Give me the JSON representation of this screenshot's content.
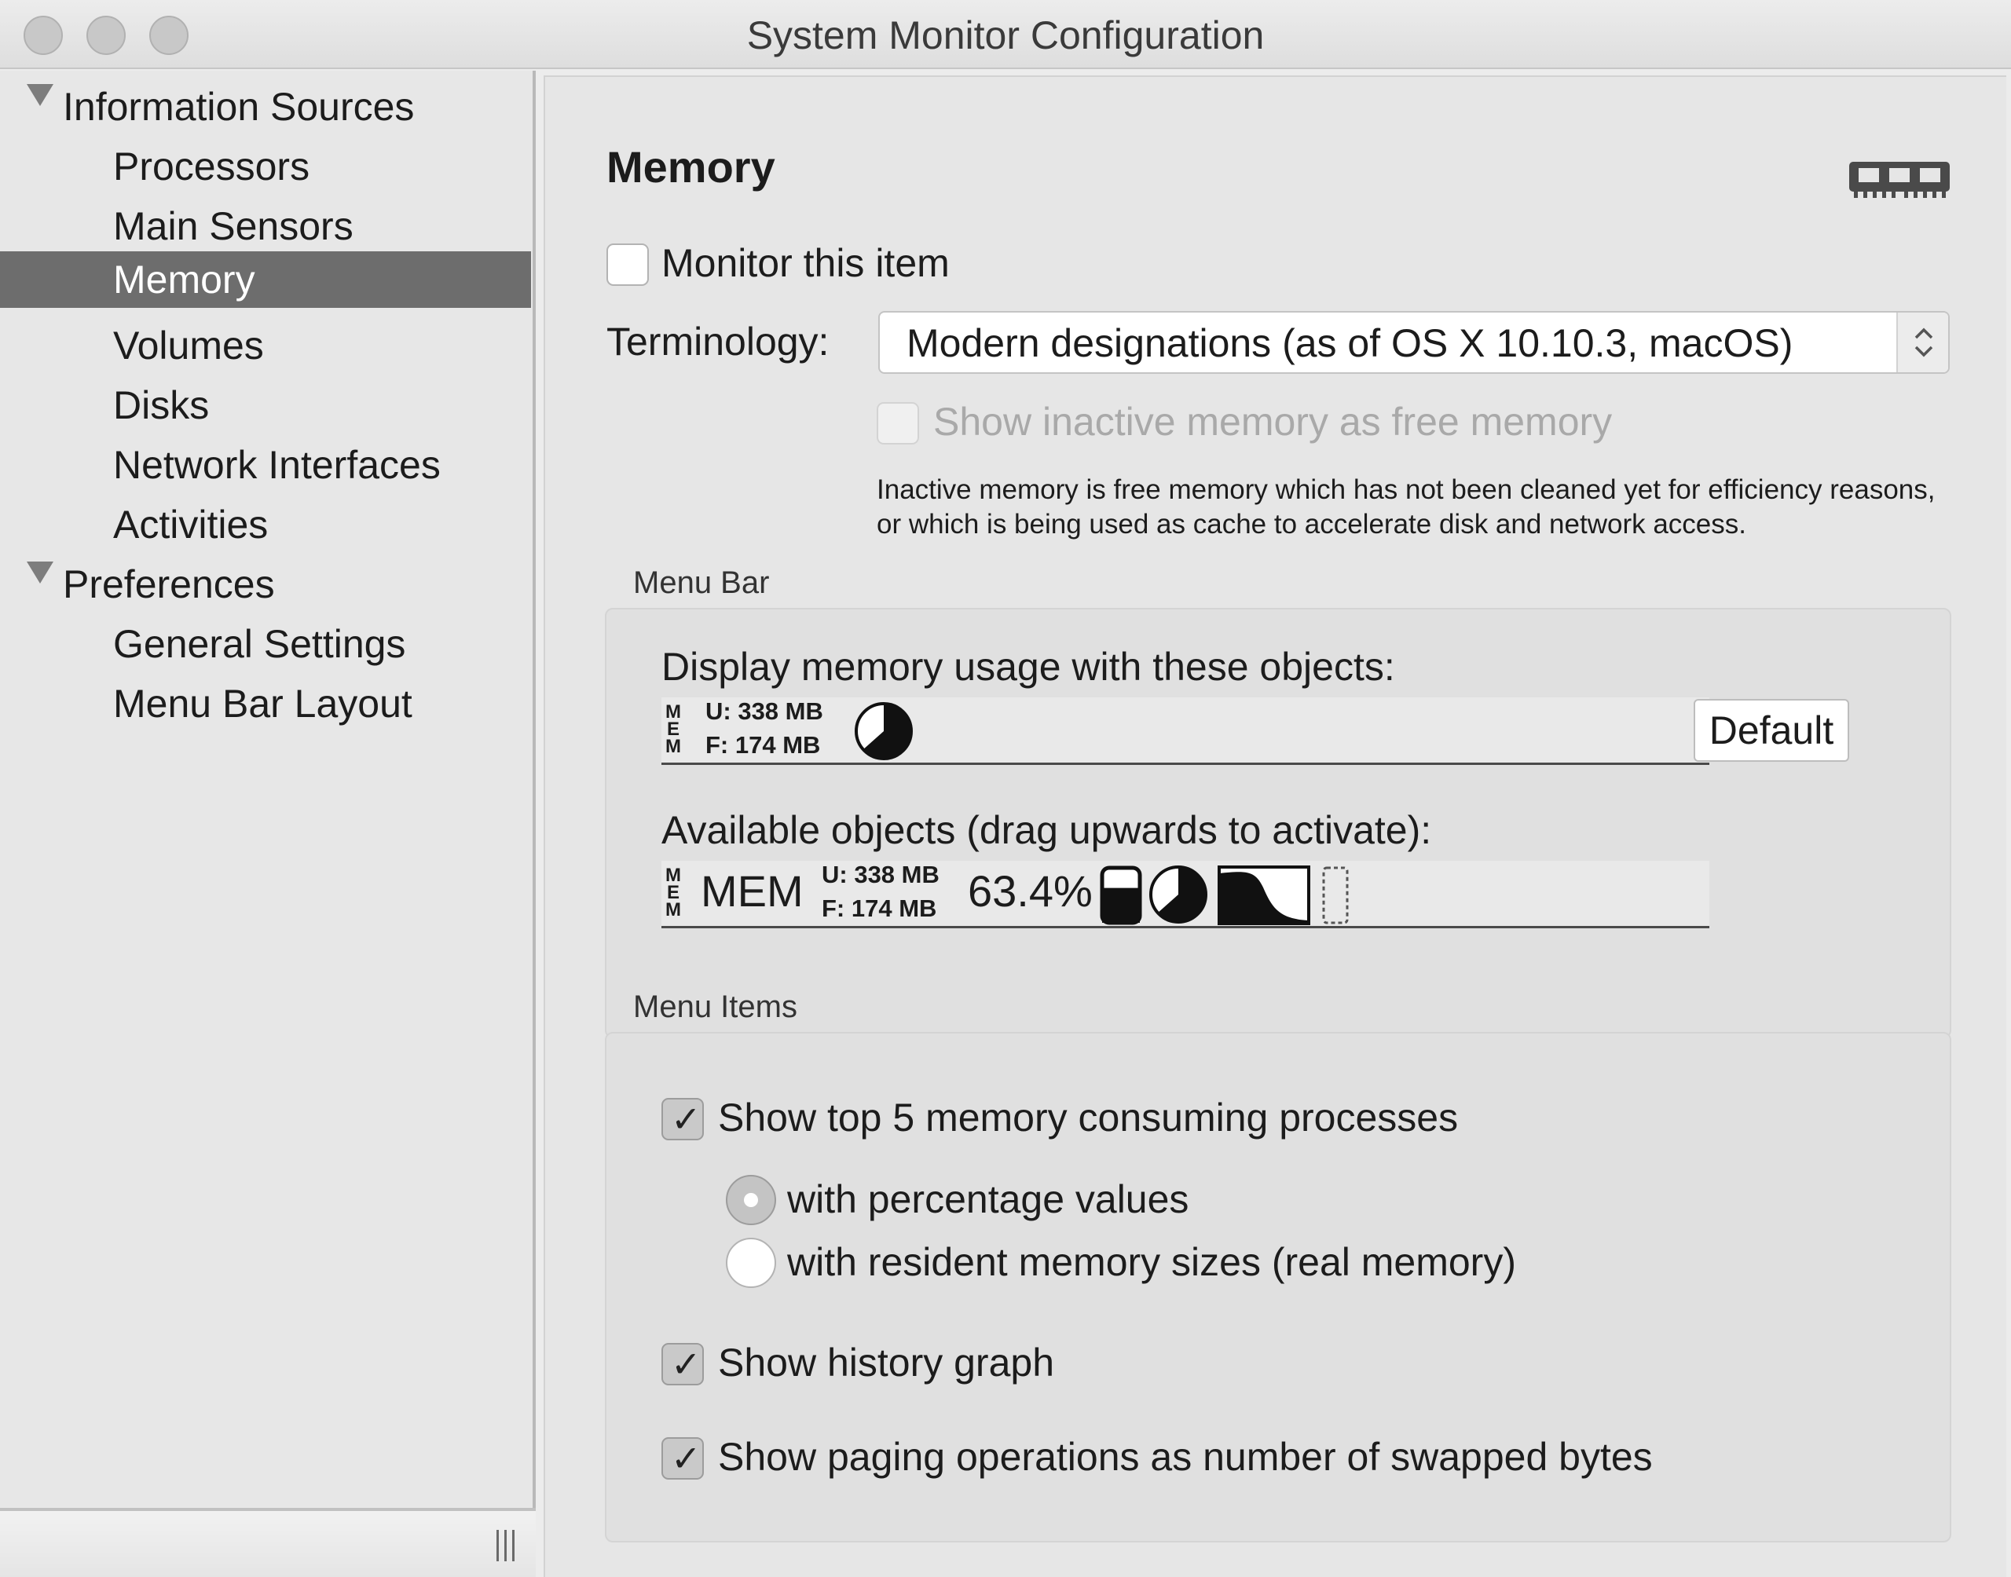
{
  "window": {
    "title": "System Monitor Configuration"
  },
  "sidebar": {
    "groups": [
      {
        "label": "Information Sources",
        "items": [
          "Processors",
          "Main Sensors",
          "Memory",
          "Volumes",
          "Disks",
          "Network Interfaces",
          "Activities"
        ]
      },
      {
        "label": "Preferences",
        "items": [
          "General Settings",
          "Menu Bar Layout"
        ]
      }
    ],
    "selected": "Memory"
  },
  "main": {
    "heading": "Memory",
    "icon": "memory-module-icon",
    "monitor": {
      "label": "Monitor this item",
      "checked": false
    },
    "terminology": {
      "label": "Terminology:",
      "value": "Modern designations (as of OS X 10.10.3, macOS)"
    },
    "inactive": {
      "label": "Show inactive memory as free memory",
      "checked": false,
      "enabled": false
    },
    "inactive_description": "Inactive memory is free memory which has not been cleaned yet for efficiency reasons, or which is being used as cache to accelerate disk and network access.",
    "menu_bar": {
      "title": "Menu Bar",
      "display_label": "Display memory usage with these objects:",
      "available_label": "Available objects (drag upwards to activate):",
      "default_button": "Default",
      "mem_letters": [
        "M",
        "E",
        "M"
      ],
      "used_line": "U: 338 MB",
      "free_line": "F:  174 MB",
      "mem_text": "MEM",
      "percent_text": "63.4%",
      "used_fraction": 0.634
    },
    "menu_items": {
      "title": "Menu Items",
      "top_processes": {
        "label": "Show top 5 memory consuming processes",
        "checked": true
      },
      "radio_percentage": {
        "label": "with percentage values",
        "selected": true
      },
      "radio_resident": {
        "label": "with resident memory sizes (real memory)",
        "selected": false
      },
      "history_graph": {
        "label": "Show history graph",
        "checked": true
      },
      "paging": {
        "label": "Show paging operations as number of swapped bytes",
        "checked": true
      }
    }
  },
  "colors": {
    "selection": "#6d6d6d",
    "window_bg": "#ececec"
  }
}
